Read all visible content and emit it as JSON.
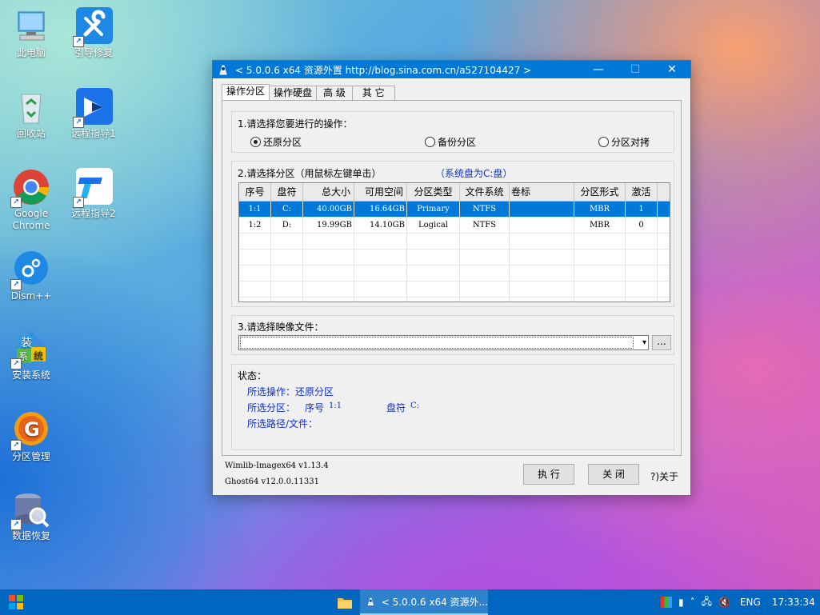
{
  "desktop": {
    "icons": [
      {
        "label": "此电脑",
        "icon": "computer-icon"
      },
      {
        "label": "引导修复",
        "icon": "wrench-icon"
      },
      {
        "label": "回收站",
        "icon": "recycle-bin-icon"
      },
      {
        "label": "远程指导1",
        "icon": "remote-icon"
      },
      {
        "label": "Google Chrome",
        "icon": "chrome-icon"
      },
      {
        "label": "远程指导2",
        "icon": "remote2-icon"
      },
      {
        "label": "Dism++",
        "icon": "gear-icon"
      },
      {
        "label": "安装系统",
        "icon": "install-icon"
      },
      {
        "label": "分区管理",
        "icon": "partition-icon"
      },
      {
        "label": "数据恢复",
        "icon": "database-icon"
      }
    ],
    "install_glyphs": [
      "装",
      "系",
      "统"
    ],
    "partition_glyph": "G"
  },
  "window": {
    "title": "< 5.0.0.6 x64 资源外置 http://blog.sina.com.cn/a527104427 >",
    "tabs": [
      "操作分区",
      "操作硬盘",
      "高 级",
      "其 它"
    ],
    "section1": {
      "label": "1.请选择您要进行的操作：",
      "options": [
        "还原分区",
        "备份分区",
        "分区对拷"
      ],
      "selected": 0
    },
    "section2": {
      "label": "2.请选择分区（用鼠标左键单击）",
      "hint": "（系统盘为C:盘）"
    },
    "table": {
      "headers": [
        "序号",
        "盘符",
        "总大小",
        "可用空间",
        "分区类型",
        "文件系统",
        "卷标",
        "分区形式",
        "激活"
      ],
      "rows": [
        [
          "1:1",
          "C:",
          "40.00GB",
          "16.64GB",
          "Primary",
          "NTFS",
          "",
          "MBR",
          "1"
        ],
        [
          "1:2",
          "D:",
          "19.99GB",
          "14.10GB",
          "Logical",
          "NTFS",
          "",
          "MBR",
          "0"
        ]
      ],
      "selected_row": 0
    },
    "section3": {
      "label": "3.请选择映像文件：",
      "value": "",
      "browse_label": "..."
    },
    "status": {
      "label": "状态：",
      "op_label": "所选操作：",
      "op_value": "还原分区",
      "part_label": "所选分区：",
      "part_no_label": "序号",
      "part_no": "1:1",
      "drive_label": "盘符",
      "drive": "C:",
      "path_label": "所选路径/文件："
    },
    "versions": [
      "Wimlib-Imagex64 v1.13.4",
      "Ghost64 v12.0.0.11331"
    ],
    "buttons": {
      "execute": "执 行",
      "close": "关 闭",
      "about": "?)关于"
    }
  },
  "taskbar": {
    "task_label": "< 5.0.0.6 x64 资源外...",
    "lang": "ENG",
    "time": "17:33:34"
  },
  "colors": {
    "accent": "#0078d7",
    "taskbar": "#0067c0",
    "status_text": "#1030c8"
  }
}
